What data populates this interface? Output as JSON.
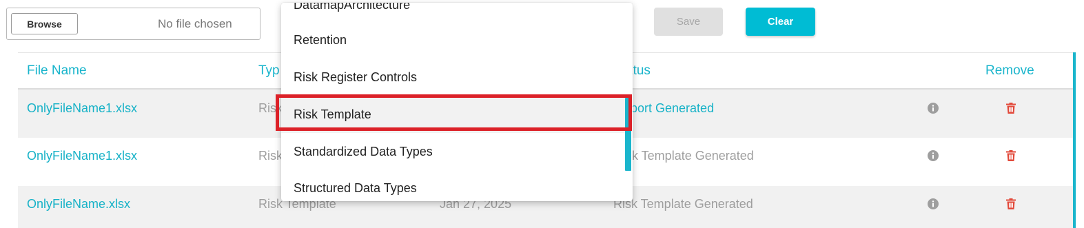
{
  "toolbar": {
    "browse_label": "Browse",
    "no_file_text": "No file chosen",
    "save_label": "Save",
    "clear_label": "Clear"
  },
  "table": {
    "headers": {
      "file_name": "File Name",
      "type": "Typ",
      "status": "atus",
      "remove": "Remove"
    },
    "rows": [
      {
        "file_name": "OnlyFileName1.xlsx",
        "type": "Risk",
        "date": "",
        "status": "port Generated"
      },
      {
        "file_name": "OnlyFileName1.xlsx",
        "type": "Risk",
        "date": "",
        "status": "k Template Generated"
      },
      {
        "file_name": "OnlyFileName.xlsx",
        "type": "Risk Template",
        "date": "Jan 27, 2025",
        "status": "Risk Template Generated"
      }
    ]
  },
  "dropdown": {
    "items": [
      "DatamapArchitecture",
      "Retention",
      "Risk Register Controls",
      "Risk Template",
      "Standardized Data Types",
      "Structured Data Types"
    ],
    "selected": "Risk Template"
  },
  "colors": {
    "accent": "#1ab5cc",
    "clear_button": "#00bcd4",
    "highlight_border": "#dc2128",
    "trash": "#e24a3b",
    "info": "#9e9e9e"
  },
  "icons": {
    "info": "info-circle-icon",
    "remove": "trash-icon"
  }
}
